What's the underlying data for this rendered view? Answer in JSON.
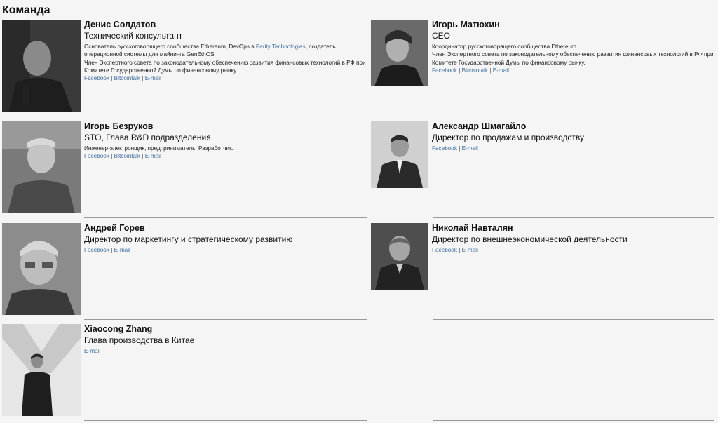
{
  "page": {
    "title": "Команда"
  },
  "members": [
    {
      "name": "Денис Солдатов",
      "role": "Технический консультант",
      "desc_part1": "Основатель русскоговорящего сообщества Ethereum, DevOps в ",
      "desc_link": "Parity Technologies",
      "desc_part2": ", создатель операционной системы для майнинга GenEthOS.",
      "desc_line2": "Член Экспертного совета по законодательному обеспечению развития финансовых технологий в РФ при Комитете Государственной Думы по финансовому рынку.",
      "links": [
        "Facebook",
        "Bitcointalk",
        "E-mail"
      ]
    },
    {
      "name": "Игорь Матюхин",
      "role": "CEO",
      "desc_line1": "Координатор русскоговорящего сообщества Ethereum.",
      "desc_line2": "Член Экспертного совета по законодательному обеспечению развития финансовых технологий в РФ при Комитете Государственной Думы по финансовому рынку.",
      "links": [
        "Facebook",
        "Bitcointalk",
        "E-mail"
      ]
    },
    {
      "name": "Игорь Безруков",
      "role": "STO, Глава R&D подразделения",
      "desc_line1": "Инженер-электронщик, предприниматель. Разработчик.",
      "links": [
        "Facebook",
        "Bitcointalk",
        "E-mail"
      ]
    },
    {
      "name": "Александр Шмагайло",
      "role": "Директор по продажам и производству",
      "links": [
        "Facebook",
        "E-mail"
      ]
    },
    {
      "name": "Андрей Горев",
      "role": "Директор по маркетингу и стратегическому развитию",
      "links": [
        "Facebook",
        "E-mail"
      ]
    },
    {
      "name": "Николай Навталян",
      "role": "Директор по внешнеэкономической деятельности",
      "links": [
        "Facebook",
        "E-mail"
      ]
    },
    {
      "name": "Xiaocong Zhang",
      "role": "Глава производства в Китае",
      "links": [
        "E-mail"
      ]
    }
  ],
  "colors": {
    "link": "#3d6e9e",
    "divider": "#9a9a9a",
    "background": "#f5f5f5"
  }
}
